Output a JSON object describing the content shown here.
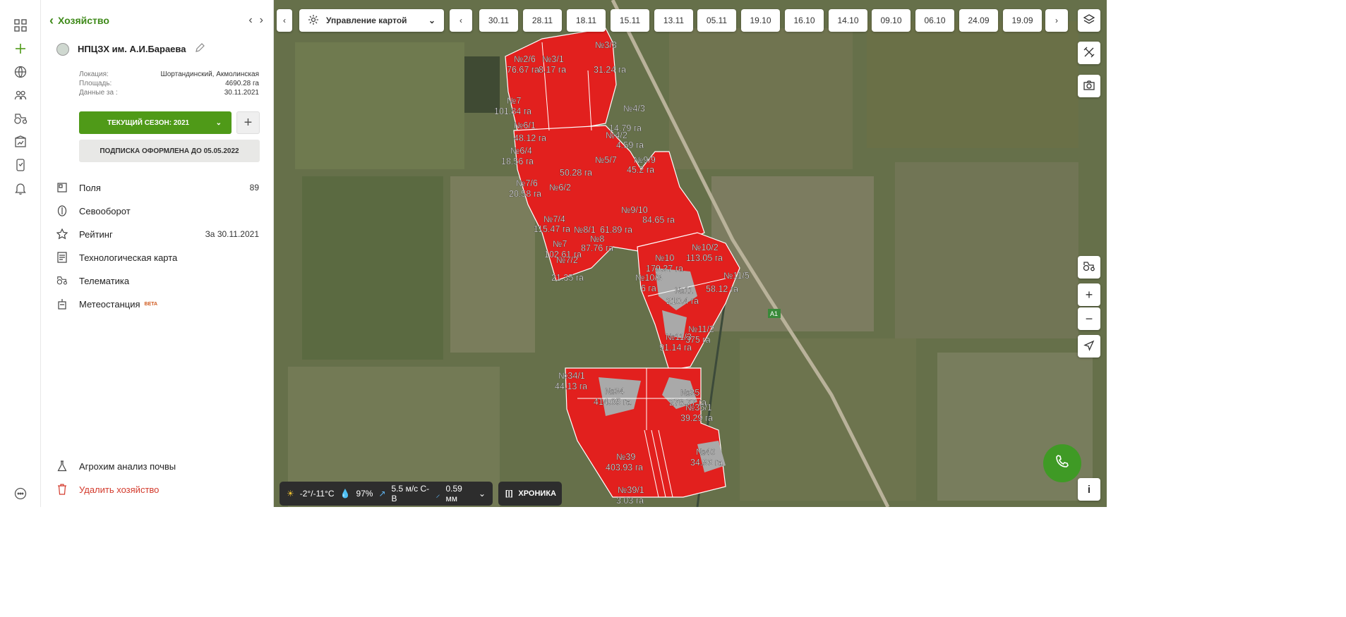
{
  "sidebar": {
    "back_label": "Хозяйство",
    "farm_name": "НПЦЗХ им. А.И.Бараева",
    "meta": [
      {
        "key": "Локация:",
        "value": "Шортандинский, Акмолинская"
      },
      {
        "key": "Площадь:",
        "value": "4690.28 га"
      },
      {
        "key": "Данные за :",
        "value": "30.11.2021"
      }
    ],
    "season_label": "ТЕКУЩИЙ СЕЗОН: 2021",
    "subscription_label": "ПОДПИСКА ОФОРМЛЕНА ДО 05.05.2022",
    "menu": [
      {
        "label": "Поля",
        "right": "89",
        "icon": "fields-icon"
      },
      {
        "label": "Севооборот",
        "right": "",
        "icon": "rotation-icon"
      },
      {
        "label": "Рейтинг",
        "right": "За 30.11.2021",
        "icon": "star-icon"
      },
      {
        "label": "Технологическая карта",
        "right": "",
        "icon": "tech-map-icon"
      },
      {
        "label": "Телематика",
        "right": "",
        "icon": "tractor-icon"
      },
      {
        "label": "Метеостанция",
        "right": "",
        "icon": "weather-station-icon",
        "badge": "BETA"
      }
    ],
    "bottom": [
      {
        "label": "Агрохим анализ почвы",
        "icon": "flask-icon"
      },
      {
        "label": "Удалить хозяйство",
        "icon": "trash-icon"
      }
    ]
  },
  "map": {
    "control_label": "Управление картой",
    "dates": [
      "30.11",
      "28.11",
      "18.11",
      "15.11",
      "13.11",
      "05.11",
      "19.10",
      "16.10",
      "14.10",
      "09.10",
      "06.10",
      "24.09",
      "19.09"
    ],
    "weather": {
      "temp": "-2°/-11°C",
      "humidity": "97%",
      "wind": "5.5 м/с С-В",
      "precip": "0.59 мм"
    },
    "chronicle_label": "ХРОНИКА",
    "road_label": "A1",
    "field_labels": [
      {
        "name": "№2/6",
        "area": "76.67 га"
      },
      {
        "name": "№3/1",
        "area": "8.17 га"
      },
      {
        "name": "№3/3",
        "area": "31.24 га"
      },
      {
        "name": "№7",
        "area": "101.84 га"
      },
      {
        "name": "№4/3",
        "area": "14.79 га"
      },
      {
        "name": "№4/2",
        "area": "4.59 га"
      },
      {
        "name": "№6/1",
        "area": "48.12 га"
      },
      {
        "name": "№5/7",
        "area": "45.2 га"
      },
      {
        "name": "№9/9",
        "area": "45.2 га"
      },
      {
        "name": "№6/4",
        "area": "18.56 га"
      },
      {
        "name": "№7/6",
        "area": "20.58 га"
      },
      {
        "name": "№6/2",
        "area": "50.28 га"
      },
      {
        "name": "№7/4",
        "area": "115.47 га"
      },
      {
        "name": "№8/1",
        "area": "61.89 га"
      },
      {
        "name": "№9/10",
        "area": "84.65 га"
      },
      {
        "name": "№8",
        "area": "87.76 га"
      },
      {
        "name": "№7",
        "area": "102.61 га"
      },
      {
        "name": "№7/2",
        "area": "21.35 га"
      },
      {
        "name": "№10",
        "area": "179.37 га"
      },
      {
        "name": "№10/2",
        "area": "113.05 га"
      },
      {
        "name": "№10/3",
        "area": "6 га"
      },
      {
        "name": "№11",
        "area": "210.4 га"
      },
      {
        "name": "№11/5",
        "area": "58.12 га"
      },
      {
        "name": "№11/2",
        "area": "375 га"
      },
      {
        "name": "№11/3",
        "area": "91.14 га"
      },
      {
        "name": "№34/1",
        "area": "44.13 га"
      },
      {
        "name": "№34",
        "area": "414.05 га"
      },
      {
        "name": "№35",
        "area": "278.77 га"
      },
      {
        "name": "№35/1",
        "area": "39.29 га"
      },
      {
        "name": "№39",
        "area": "403.93 га"
      },
      {
        "name": "№40",
        "area": "34.96 га"
      },
      {
        "name": "№39/1",
        "area": "3.03 га"
      }
    ]
  },
  "colors": {
    "brand_green": "#4f9a18",
    "field_red": "#e2201e",
    "danger": "#d33a2c"
  }
}
